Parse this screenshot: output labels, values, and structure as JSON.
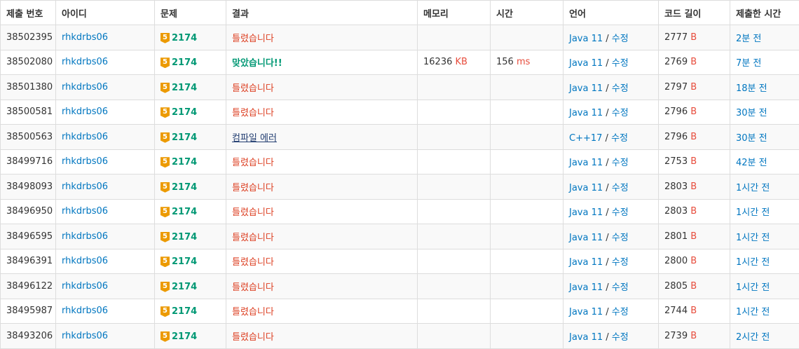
{
  "headers": [
    "제출 번호",
    "아이디",
    "문제",
    "결과",
    "메모리",
    "시간",
    "언어",
    "코드 길이",
    "제출한 시간"
  ],
  "rows": [
    {
      "id": "38502395",
      "user": "rhkdrbs06",
      "tier": "5",
      "problem": "2174",
      "result": "틀렸습니다",
      "result_type": "wrong",
      "memory": "",
      "memory_unit": "",
      "time": "",
      "time_unit": "",
      "lang": "Java 11",
      "edit": "수정",
      "code_len": "2777",
      "code_unit": "B",
      "submitted": "2분 전"
    },
    {
      "id": "38502080",
      "user": "rhkdrbs06",
      "tier": "5",
      "problem": "2174",
      "result": "맞았습니다!!",
      "result_type": "ok",
      "memory": "16236",
      "memory_unit": "KB",
      "time": "156",
      "time_unit": "ms",
      "lang": "Java 11",
      "edit": "수정",
      "code_len": "2769",
      "code_unit": "B",
      "submitted": "7분 전"
    },
    {
      "id": "38501380",
      "user": "rhkdrbs06",
      "tier": "5",
      "problem": "2174",
      "result": "틀렸습니다",
      "result_type": "wrong",
      "memory": "",
      "memory_unit": "",
      "time": "",
      "time_unit": "",
      "lang": "Java 11",
      "edit": "수정",
      "code_len": "2797",
      "code_unit": "B",
      "submitted": "18분 전"
    },
    {
      "id": "38500581",
      "user": "rhkdrbs06",
      "tier": "5",
      "problem": "2174",
      "result": "틀렸습니다",
      "result_type": "wrong",
      "memory": "",
      "memory_unit": "",
      "time": "",
      "time_unit": "",
      "lang": "Java 11",
      "edit": "수정",
      "code_len": "2796",
      "code_unit": "B",
      "submitted": "30분 전"
    },
    {
      "id": "38500563",
      "user": "rhkdrbs06",
      "tier": "5",
      "problem": "2174",
      "result": "컴파일 에러",
      "result_type": "ce",
      "memory": "",
      "memory_unit": "",
      "time": "",
      "time_unit": "",
      "lang": "C++17",
      "edit": "수정",
      "code_len": "2796",
      "code_unit": "B",
      "submitted": "30분 전"
    },
    {
      "id": "38499716",
      "user": "rhkdrbs06",
      "tier": "5",
      "problem": "2174",
      "result": "틀렸습니다",
      "result_type": "wrong",
      "memory": "",
      "memory_unit": "",
      "time": "",
      "time_unit": "",
      "lang": "Java 11",
      "edit": "수정",
      "code_len": "2753",
      "code_unit": "B",
      "submitted": "42분 전"
    },
    {
      "id": "38498093",
      "user": "rhkdrbs06",
      "tier": "5",
      "problem": "2174",
      "result": "틀렸습니다",
      "result_type": "wrong",
      "memory": "",
      "memory_unit": "",
      "time": "",
      "time_unit": "",
      "lang": "Java 11",
      "edit": "수정",
      "code_len": "2803",
      "code_unit": "B",
      "submitted": "1시간 전"
    },
    {
      "id": "38496950",
      "user": "rhkdrbs06",
      "tier": "5",
      "problem": "2174",
      "result": "틀렸습니다",
      "result_type": "wrong",
      "memory": "",
      "memory_unit": "",
      "time": "",
      "time_unit": "",
      "lang": "Java 11",
      "edit": "수정",
      "code_len": "2803",
      "code_unit": "B",
      "submitted": "1시간 전"
    },
    {
      "id": "38496595",
      "user": "rhkdrbs06",
      "tier": "5",
      "problem": "2174",
      "result": "틀렸습니다",
      "result_type": "wrong",
      "memory": "",
      "memory_unit": "",
      "time": "",
      "time_unit": "",
      "lang": "Java 11",
      "edit": "수정",
      "code_len": "2801",
      "code_unit": "B",
      "submitted": "1시간 전"
    },
    {
      "id": "38496391",
      "user": "rhkdrbs06",
      "tier": "5",
      "problem": "2174",
      "result": "틀렸습니다",
      "result_type": "wrong",
      "memory": "",
      "memory_unit": "",
      "time": "",
      "time_unit": "",
      "lang": "Java 11",
      "edit": "수정",
      "code_len": "2800",
      "code_unit": "B",
      "submitted": "1시간 전"
    },
    {
      "id": "38496122",
      "user": "rhkdrbs06",
      "tier": "5",
      "problem": "2174",
      "result": "틀렸습니다",
      "result_type": "wrong",
      "memory": "",
      "memory_unit": "",
      "time": "",
      "time_unit": "",
      "lang": "Java 11",
      "edit": "수정",
      "code_len": "2805",
      "code_unit": "B",
      "submitted": "1시간 전"
    },
    {
      "id": "38495987",
      "user": "rhkdrbs06",
      "tier": "5",
      "problem": "2174",
      "result": "틀렸습니다",
      "result_type": "wrong",
      "memory": "",
      "memory_unit": "",
      "time": "",
      "time_unit": "",
      "lang": "Java 11",
      "edit": "수정",
      "code_len": "2744",
      "code_unit": "B",
      "submitted": "1시간 전"
    },
    {
      "id": "38493206",
      "user": "rhkdrbs06",
      "tier": "5",
      "problem": "2174",
      "result": "틀렸습니다",
      "result_type": "wrong",
      "memory": "",
      "memory_unit": "",
      "time": "",
      "time_unit": "",
      "lang": "Java 11",
      "edit": "수정",
      "code_len": "2739",
      "code_unit": "B",
      "submitted": "2시간 전"
    }
  ],
  "colors": {
    "link": "#0076c0",
    "accepted": "#009874",
    "wrong": "#dd4124",
    "compile_error": "#1f3b6f",
    "unit_red": "#e74c3c",
    "tier_badge": "#ec9a00",
    "stripe": "#f9f9f9",
    "border": "#dddddd"
  },
  "icons": {
    "tier_badge": "silver-tier-badge-icon"
  }
}
